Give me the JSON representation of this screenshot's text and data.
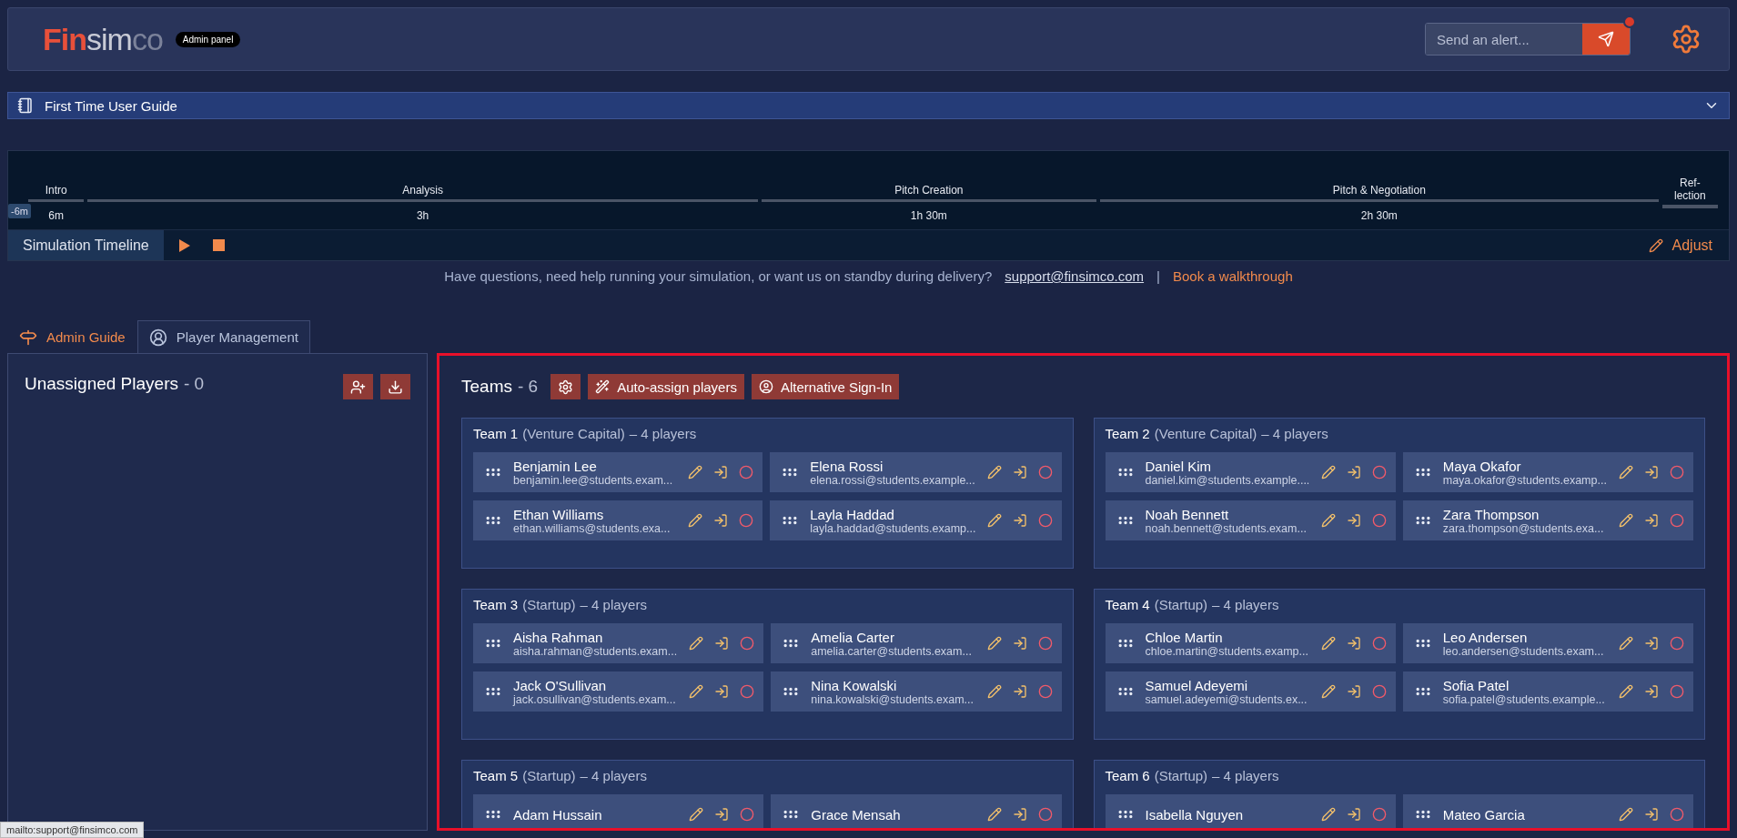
{
  "header": {
    "logo_parts": [
      "Fin",
      "sim",
      "co"
    ],
    "badge": "Admin panel",
    "alert_placeholder": "Send an alert...",
    "has_notification": true
  },
  "guide": {
    "title": "First Time User Guide",
    "expanded": false
  },
  "timeline": {
    "segments": [
      {
        "label": "Intro",
        "duration": "6m"
      },
      {
        "label": "Analysis",
        "duration": "3h"
      },
      {
        "label": "Pitch Creation",
        "duration": "1h 30m"
      },
      {
        "label": "Pitch & Negotiation",
        "duration": "2h 30m"
      },
      {
        "label": "Ref-\nlection"
      }
    ],
    "offset_badge": "-6m",
    "title": "Simulation Timeline",
    "adjust": "Adjust"
  },
  "help": {
    "text": "Have questions, need help running your simulation, or want us on standby during delivery?",
    "email": "support@finsimco.com",
    "separator": "|",
    "walkthrough": "Book a walkthrough"
  },
  "tabs": [
    {
      "label": "Admin Guide",
      "selected": false,
      "kind": "guide"
    },
    {
      "label": "Player Management",
      "selected": true,
      "kind": "players"
    }
  ],
  "unassigned": {
    "title": "Unassigned Players",
    "count": "- 0"
  },
  "teams_panel": {
    "title": "Teams",
    "count": "- 6",
    "highlighted": true,
    "buttons": [
      "Auto-assign players",
      "Alternative Sign-In"
    ]
  },
  "teams": [
    {
      "name": "Team 1",
      "type": "(Venture Capital)",
      "count": "– 4 players",
      "players": [
        {
          "name": "Benjamin Lee",
          "email": "benjamin.lee@students.exam..."
        },
        {
          "name": "Elena Rossi",
          "email": "elena.rossi@students.example..."
        },
        {
          "name": "Ethan Williams",
          "email": "ethan.williams@students.exa..."
        },
        {
          "name": "Layla Haddad",
          "email": "layla.haddad@students.examp..."
        }
      ]
    },
    {
      "name": "Team 2",
      "type": "(Venture Capital)",
      "count": "– 4 players",
      "players": [
        {
          "name": "Daniel Kim",
          "email": "daniel.kim@students.example...."
        },
        {
          "name": "Maya Okafor",
          "email": "maya.okafor@students.examp..."
        },
        {
          "name": "Noah Bennett",
          "email": "noah.bennett@students.exam..."
        },
        {
          "name": "Zara Thompson",
          "email": "zara.thompson@students.exa..."
        }
      ]
    },
    {
      "name": "Team 3",
      "type": "(Startup)",
      "count": "– 4 players",
      "players": [
        {
          "name": "Aisha Rahman",
          "email": "aisha.rahman@students.exam..."
        },
        {
          "name": "Amelia Carter",
          "email": "amelia.carter@students.exam..."
        },
        {
          "name": "Jack O'Sullivan",
          "email": "jack.osullivan@students.exam..."
        },
        {
          "name": "Nina Kowalski",
          "email": "nina.kowalski@students.exam..."
        }
      ]
    },
    {
      "name": "Team 4",
      "type": "(Startup)",
      "count": "– 4 players",
      "players": [
        {
          "name": "Chloe Martin",
          "email": "chloe.martin@students.examp..."
        },
        {
          "name": "Leo Andersen",
          "email": "leo.andersen@students.exam..."
        },
        {
          "name": "Samuel Adeyemi",
          "email": "samuel.adeyemi@students.ex..."
        },
        {
          "name": "Sofia Patel",
          "email": "sofia.patel@students.example..."
        }
      ]
    },
    {
      "name": "Team 5",
      "type": "(Startup)",
      "count": "– 4 players",
      "players": [
        {
          "name": "Adam Hussain"
        },
        {
          "name": "Grace Mensah"
        }
      ]
    },
    {
      "name": "Team 6",
      "type": "(Startup)",
      "count": "– 4 players",
      "players": [
        {
          "name": "Isabella Nguyen"
        },
        {
          "name": "Mateo Garcia"
        }
      ]
    }
  ],
  "status_url": "mailto:support@finsimco.com"
}
